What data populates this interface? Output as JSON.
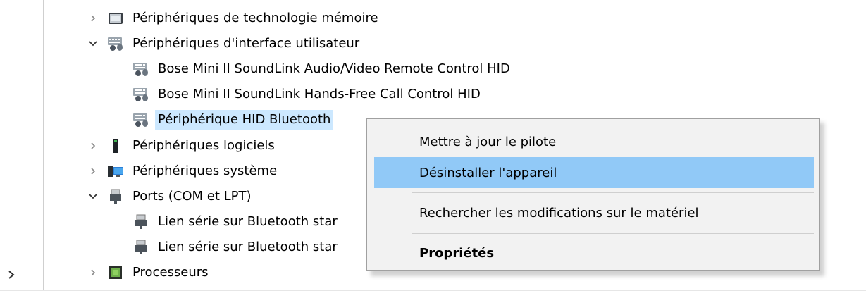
{
  "tree": {
    "items": [
      {
        "label": "Périphériques de technologie mémoire",
        "state": "collapsed",
        "icon": "memory-technology-icon"
      },
      {
        "label": "Périphériques d'interface utilisateur",
        "state": "expanded",
        "icon": "hid-device-icon"
      },
      {
        "label": "Bose Mini II SoundLink Audio/Video Remote Control HID",
        "state": "leaf",
        "icon": "hid-device-icon"
      },
      {
        "label": "Bose Mini II SoundLink Hands-Free Call Control HID",
        "state": "leaf",
        "icon": "hid-device-icon"
      },
      {
        "label": "Périphérique HID Bluetooth",
        "state": "leaf",
        "icon": "hid-device-icon",
        "selected": true
      },
      {
        "label": "Périphériques logiciels",
        "state": "collapsed",
        "icon": "software-device-icon"
      },
      {
        "label": "Périphériques système",
        "state": "collapsed",
        "icon": "system-device-icon"
      },
      {
        "label": "Ports (COM et LPT)",
        "state": "expanded",
        "icon": "port-icon"
      },
      {
        "label": "Lien série sur Bluetooth star",
        "state": "leaf",
        "icon": "port-icon"
      },
      {
        "label": "Lien série sur Bluetooth star",
        "state": "leaf",
        "icon": "port-icon"
      },
      {
        "label": "Processeurs",
        "state": "collapsed",
        "icon": "processor-icon"
      }
    ]
  },
  "context_menu": {
    "items": [
      {
        "label": "Mettre à jour le pilote"
      },
      {
        "label": "Désinstaller l'appareil",
        "highlighted": true
      },
      {
        "label": "Rechercher les modifications sur le matériel"
      },
      {
        "label": "Propriétés",
        "bold": true
      }
    ]
  },
  "colors": {
    "menu_background": "#f2f2f2",
    "menu_highlight": "#91c9f7",
    "selection_background": "#cce8ff"
  }
}
